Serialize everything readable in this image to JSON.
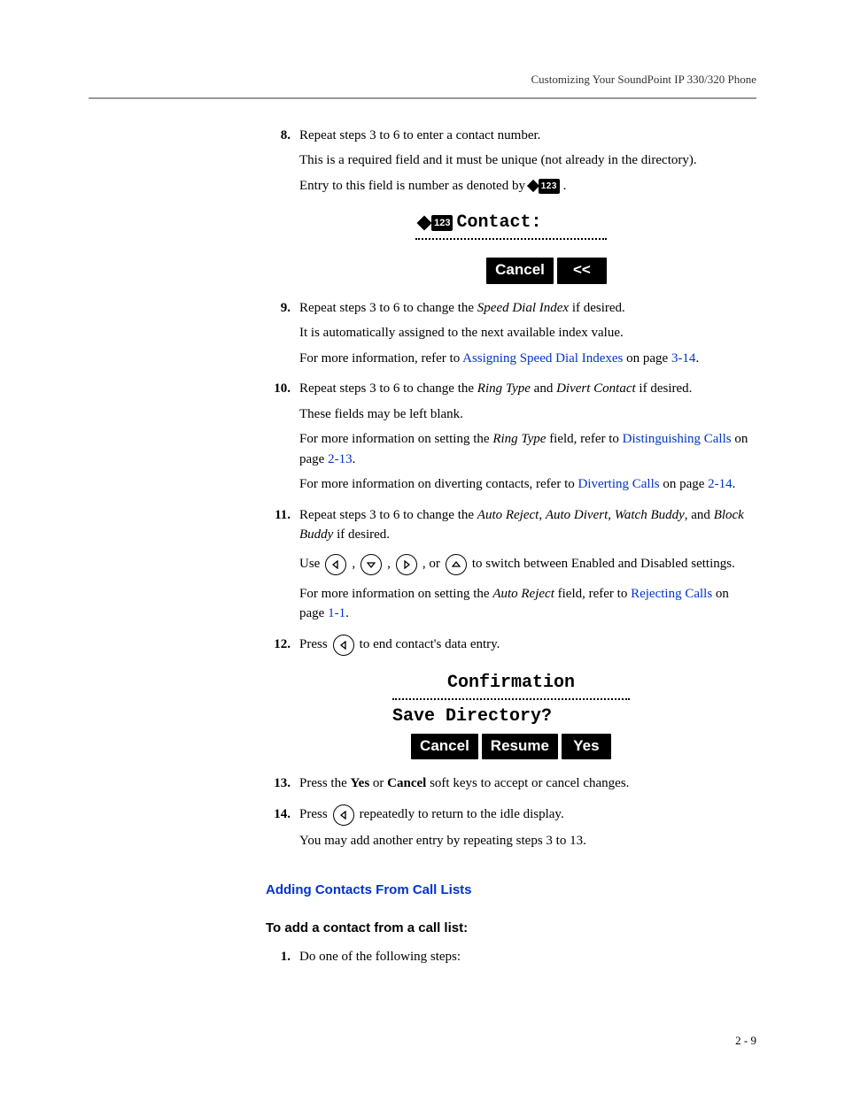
{
  "header": {
    "title": "Customizing Your SoundPoint IP 330/320 Phone"
  },
  "steps": {
    "s8": {
      "num": "8.",
      "line1": "Repeat steps 3 to 6 to enter a contact number.",
      "line2": "This is a required field and it must be unique (not already in the directory).",
      "line3_a": "Entry to this field is number as denoted by ",
      "line3_b": ".",
      "icon_label": "123"
    },
    "lcd1": {
      "prefix_icon": "123",
      "label": "Contact:",
      "softkey_cancel": "Cancel",
      "softkey_back": "<<"
    },
    "s9": {
      "num": "9.",
      "line1_a": "Repeat steps 3 to 6 to change the ",
      "line1_i": "Speed Dial Index",
      "line1_b": " if desired.",
      "line2": "It is automatically assigned to the next available index value.",
      "line3_a": "For more information, refer to ",
      "link1": "Assigning Speed Dial Indexes",
      "line3_b": " on page ",
      "link2": "3-14",
      "line3_c": "."
    },
    "s10": {
      "num": "10.",
      "line1_a": "Repeat steps 3 to 6 to change the ",
      "line1_i1": "Ring Type",
      "line1_b": " and ",
      "line1_i2": "Divert Contact",
      "line1_c": " if desired.",
      "line2": "These fields may be left blank.",
      "line3_a": "For more information on setting the ",
      "line3_i": "Ring Type",
      "line3_b": " field, refer to ",
      "link1": "Distinguishing Calls",
      "line3_c": " on page ",
      "link2": "2-13",
      "line3_d": ".",
      "line4_a": "For more information on diverting contacts, refer to ",
      "link3": "Diverting Calls",
      "line4_b": " on page ",
      "link4": "2-14",
      "line4_c": "."
    },
    "s11": {
      "num": "11.",
      "line1_a": "Repeat steps 3 to 6 to change the ",
      "i1": "Auto Reject",
      "sep1": ", ",
      "i2": "Auto Divert",
      "sep2": ", ",
      "i3": "Watch Buddy",
      "sep3": ", and ",
      "i4": "Block Buddy",
      "line1_b": " if desired.",
      "use_a": "Use ",
      "use_sep1": ", ",
      "use_sep2": ", ",
      "use_sep3": ", or ",
      "use_b": " to switch between Enabled and Disabled settings.",
      "line3_a": "For more information on setting the ",
      "line3_i": "Auto Reject",
      "line3_b": " field, refer to ",
      "link1": "Rejecting Calls",
      "line3_c": " on page ",
      "link2": "1-1",
      "line3_d": "."
    },
    "s12": {
      "num": "12.",
      "line1_a": "Press ",
      "line1_b": " to end contact's data entry."
    },
    "lcd2": {
      "title": "Confirmation",
      "question": "Save Directory?",
      "sk_cancel": "Cancel",
      "sk_resume": "Resume",
      "sk_yes": "Yes"
    },
    "s13": {
      "num": "13.",
      "line1_a": "Press the ",
      "b1": "Yes",
      "mid": " or ",
      "b2": "Cancel",
      "line1_b": " soft keys to accept or cancel changes."
    },
    "s14": {
      "num": "14.",
      "line1_a": "Press ",
      "line1_b": " repeatedly to return to the idle display.",
      "line2": "You may add another entry by repeating steps 3 to 13."
    }
  },
  "section_heading": "Adding Contacts From Call Lists",
  "sub_heading": "To add a contact from a call list:",
  "sub_step": {
    "num": "1.",
    "text": "Do one of the following steps:"
  },
  "footer": "2 - 9"
}
